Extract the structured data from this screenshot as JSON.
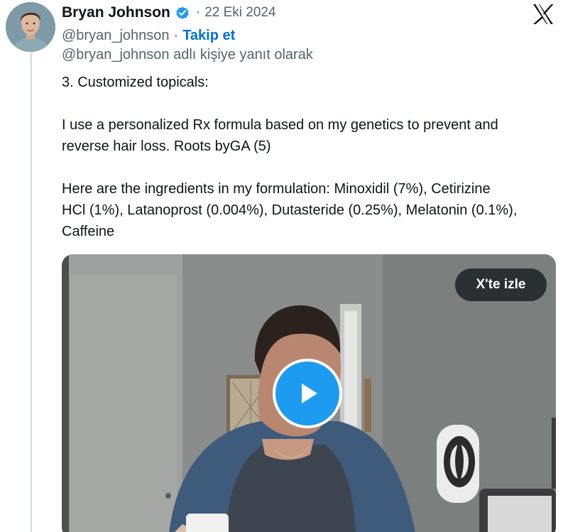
{
  "author": {
    "display_name": "Bryan Johnson",
    "handle": "@bryan_johnson",
    "verified": true,
    "avatar": "profile-photo"
  },
  "post": {
    "separator": "·",
    "date": "22 Eki 2024",
    "follow_separator": "·",
    "follow_label": "Takip et",
    "reply_context": "@bryan_johnson adlı kişiye yanıt olarak",
    "paragraphs": [
      {
        "lines": [
          "3. Customized topicals:"
        ]
      },
      {
        "lines": [
          "I use a personalized Rx formula based on my genetics to prevent and",
          "reverse hair loss. Roots byGA (5)"
        ]
      },
      {
        "lines": [
          "Here are the ingredients in my formulation: Minoxidil (7%), Cetirizine",
          "HCl (1%), Latanoprost (0.004%), Dutasteride (0.25%), Melatonin (0.1%),",
          "Caffeine"
        ]
      }
    ]
  },
  "media": {
    "type": "video",
    "watch_label": "X'te izle",
    "play_icon": "play-icon"
  },
  "brand": {
    "logo": "x-logo",
    "link_color": "#006fd6",
    "verified_color": "#1d9bf0",
    "play_color": "#1d9bf0",
    "muted_text_color": "#536471"
  }
}
